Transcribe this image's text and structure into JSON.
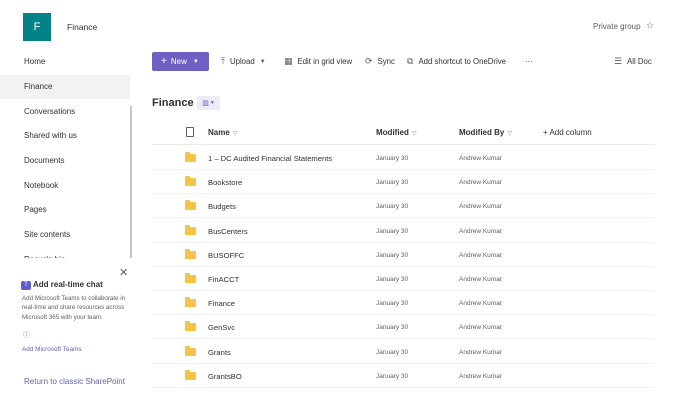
{
  "site": {
    "logo_letter": "F",
    "title": "Finance",
    "privacy": "Private group",
    "follow_icon": "star-icon"
  },
  "nav": {
    "items": [
      {
        "label": "Home",
        "active": false
      },
      {
        "label": "Finance",
        "active": true
      },
      {
        "label": "Conversations",
        "active": false
      },
      {
        "label": "Shared with us",
        "active": false
      },
      {
        "label": "Documents",
        "active": false
      },
      {
        "label": "Notebook",
        "active": false
      },
      {
        "label": "Pages",
        "active": false
      },
      {
        "label": "Site contents",
        "active": false
      },
      {
        "label": "Recycle bin",
        "active": false
      }
    ],
    "promo": {
      "close": "✕",
      "title": "Add real-time chat",
      "text": "Add Microsoft Teams to collaborate in real-time and share resources across Microsoft 365 with your team.",
      "info": "ⓘ",
      "link": "Add Microsoft Teams"
    },
    "return_link": "Return to classic SharePoint"
  },
  "commandbar": {
    "new_label": "New",
    "upload_label": "Upload",
    "grid_label": "Edit in grid view",
    "sync_label": "Sync",
    "shortcut_label": "Add shortcut to OneDrive",
    "more_label": "···",
    "view_label": "All Doc"
  },
  "library": {
    "title": "Finance"
  },
  "table": {
    "headers": {
      "name": "Name",
      "modified": "Modified",
      "modified_by": "Modified By",
      "add_column": "+ Add column"
    },
    "rows": [
      {
        "name": "1 – DC Audited Financial Statements",
        "modified": "January 30",
        "modified_by": "Andrew Kumar"
      },
      {
        "name": "Bookstore",
        "modified": "January 30",
        "modified_by": "Andrew Kumar"
      },
      {
        "name": "Budgets",
        "modified": "January 30",
        "modified_by": "Andrew Kumar"
      },
      {
        "name": "BusCenters",
        "modified": "January 30",
        "modified_by": "Andrew Kumar"
      },
      {
        "name": "BUSOFFC",
        "modified": "January 30",
        "modified_by": "Andrew Kumar"
      },
      {
        "name": "FinACCT",
        "modified": "January 30",
        "modified_by": "Andrew Kumar"
      },
      {
        "name": "Finance",
        "modified": "January 30",
        "modified_by": "Andrew Kumar"
      },
      {
        "name": "GenSvc",
        "modified": "January 30",
        "modified_by": "Andrew Kumar"
      },
      {
        "name": "Grants",
        "modified": "January 30",
        "modified_by": "Andrew Kumar"
      },
      {
        "name": "GrantsBO",
        "modified": "January 30",
        "modified_by": "Andrew Kumar"
      }
    ]
  },
  "colors": {
    "accent": "#7160c4",
    "site_logo": "#038387",
    "folder": "#f6c445",
    "link": "#6264a7"
  }
}
